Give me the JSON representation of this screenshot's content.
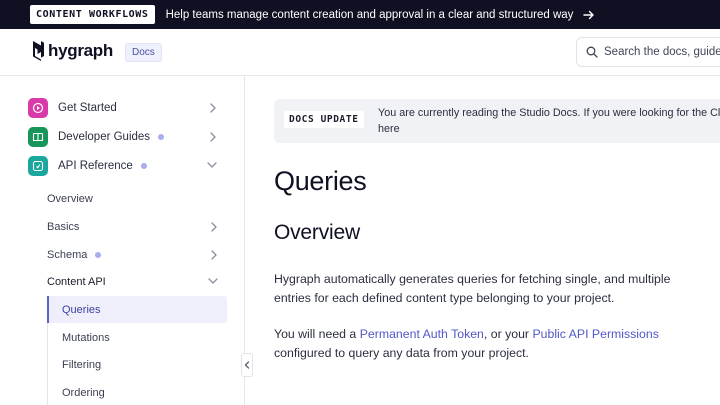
{
  "announcement": {
    "tag": "CONTENT WORKFLOWS",
    "message": "Help teams manage content creation and approval in a clear and structured way"
  },
  "header": {
    "logo": "hygraph",
    "badge": "Docs",
    "search_placeholder": "Search the docs, guides"
  },
  "sidebar": {
    "items": [
      {
        "label": "Get Started",
        "icon": "play-icon",
        "color": "#d83aa8",
        "dot": false,
        "chevron": "right"
      },
      {
        "label": "Developer Guides",
        "icon": "book-icon",
        "color": "#17955a",
        "dot": true,
        "chevron": "right"
      },
      {
        "label": "API Reference",
        "icon": "code-icon",
        "color": "#1ca79e",
        "dot": true,
        "chevron": "down"
      }
    ],
    "sub_items": [
      {
        "label": "Overview"
      },
      {
        "label": "Basics"
      },
      {
        "label": "Schema"
      },
      {
        "label": "Content API"
      }
    ],
    "content_api_items": [
      {
        "label": "Queries"
      },
      {
        "label": "Mutations"
      },
      {
        "label": "Filtering"
      },
      {
        "label": "Ordering"
      }
    ]
  },
  "callout": {
    "label": "DOCS UPDATE",
    "text_line1": "You are currently reading the Studio Docs. If you were looking for the Clas",
    "text_line2": "here"
  },
  "main": {
    "title": "Queries",
    "section_title": "Overview",
    "para1": "Hygraph automatically generates queries for fetching single, and multiple entries for each defined content type belonging to your project.",
    "para2_prefix": "You will need a ",
    "para2_link1": "Permanent Auth Token",
    "para2_mid": ", or your ",
    "para2_link2": "Public API Permissions",
    "para2_suffix": " configured to query any data from your project."
  },
  "colors": {
    "accent": "#5257c9",
    "announcement_bg": "#0f1123"
  }
}
